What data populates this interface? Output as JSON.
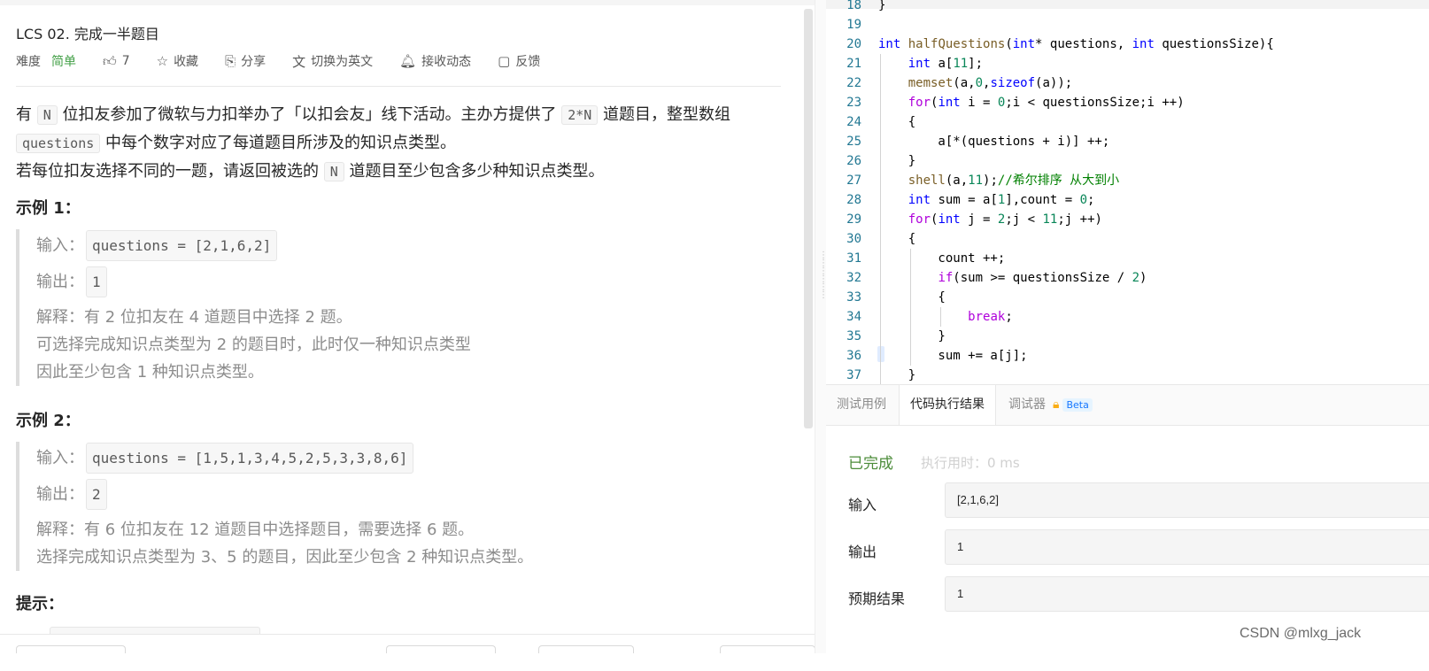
{
  "problem": {
    "title": "LCS 02. 完成一半题目",
    "difficulty_label": "难度",
    "difficulty": "简单",
    "likes": "7",
    "collect": "收藏",
    "share": "分享",
    "switch_lang": "切换为英文",
    "subscribe": "接收动态",
    "feedback": "反馈"
  },
  "description": {
    "p1_a": "有 ",
    "p1_code_n": "N",
    "p1_b": " 位扣友参加了微软与力扣举办了「以扣会友」线下活动。主办方提供了 ",
    "p1_code_2n": "2*N",
    "p1_c": " 道题目，整型数组 ",
    "p1_code_questions": "questions",
    "p1_d": " 中每个数字对应了每道题目所涉及的知识点类型。",
    "p2_a": "若每位扣友选择不同的一题，请返回被选的 ",
    "p2_code_n": "N",
    "p2_b": " 道题目至少包含多少种知识点类型。"
  },
  "examples": [
    {
      "heading": "示例 1：",
      "input_label": "输入：",
      "input": "questions = [2,1,6,2]",
      "output_label": "输出：",
      "output": "1",
      "explain": [
        "解释：有 2 位扣友在 4 道题目中选择 2 题。",
        "可选择完成知识点类型为 2 的题目时，此时仅一种知识点类型",
        "因此至少包含 1 种知识点类型。"
      ]
    },
    {
      "heading": "示例 2：",
      "input_label": "输入：",
      "input": "questions = [1,5,1,3,4,5,2,5,3,3,8,6]",
      "output_label": "输出：",
      "output": "2",
      "explain": [
        "解释：有 6 位扣友在 12 道题目中选择题目，需要选择 6 题。",
        "选择完成知识点类型为 3、5 的题目，因此至少包含 2 种知识点类型。"
      ]
    }
  ],
  "hints_heading": "提示：",
  "editor": {
    "line_numbers": [
      "18",
      "19",
      "20",
      "21",
      "22",
      "23",
      "24",
      "25",
      "26",
      "27",
      "28",
      "29",
      "30",
      "31",
      "32",
      "33",
      "34",
      "35",
      "36",
      "37"
    ]
  },
  "console": {
    "tab_testcase": "测试用例",
    "tab_result": "代码执行结果",
    "tab_debugger": "调试器",
    "beta": "Beta",
    "status": "已完成",
    "runtime": "执行用时：0 ms",
    "input_label": "输入",
    "input_value": "[2,1,6,2]",
    "output_label": "输出",
    "output_value": "1",
    "expected_label": "预期结果",
    "expected_value": "1"
  },
  "watermark": "CSDN @mlxg_jack",
  "colors": {
    "easy": "#43a047",
    "accepted": "#4c8c3a",
    "line_number": "#237893",
    "keyword": "#0000ff",
    "control": "#af00db",
    "function": "#795e26",
    "number": "#098658",
    "comment": "#008000"
  }
}
